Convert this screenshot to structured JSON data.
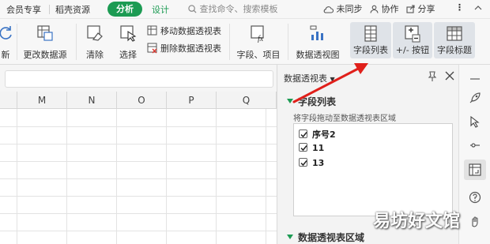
{
  "menu": {
    "items": [
      "会员专享",
      "稻壳资源"
    ],
    "active_tab": "分析",
    "design_tab": "设计",
    "search_placeholder": "查找命令、搜索模板",
    "sync": "未同步",
    "collab": "协作",
    "share": "分享"
  },
  "ribbon": {
    "refresh": "新",
    "change_source": "更改数据源",
    "clear": "清除",
    "select": "选择",
    "move_pivot": "移动数据透视表",
    "delete_pivot": "删除数据透视表",
    "fields_items": "字段、项目",
    "pivot_chart": "数据透视图",
    "field_list": "字段列表",
    "plus_minus": "+/- 按钮",
    "field_headers": "字段标题"
  },
  "grid": {
    "columns": [
      "M",
      "N",
      "O",
      "P",
      "Q"
    ]
  },
  "panel": {
    "title": "数据透视表",
    "section_fields": "字段列表",
    "section_desc": "将字段拖动至数据透视表区域",
    "fields": [
      {
        "label": "序号2",
        "checked": true
      },
      {
        "label": "11",
        "checked": true
      },
      {
        "label": "13",
        "checked": true
      }
    ],
    "section_areas": "数据透视表区域"
  },
  "watermark": "易坊好文馆",
  "colors": {
    "accent": "#1c9b53",
    "arrow": "#e0201b"
  }
}
